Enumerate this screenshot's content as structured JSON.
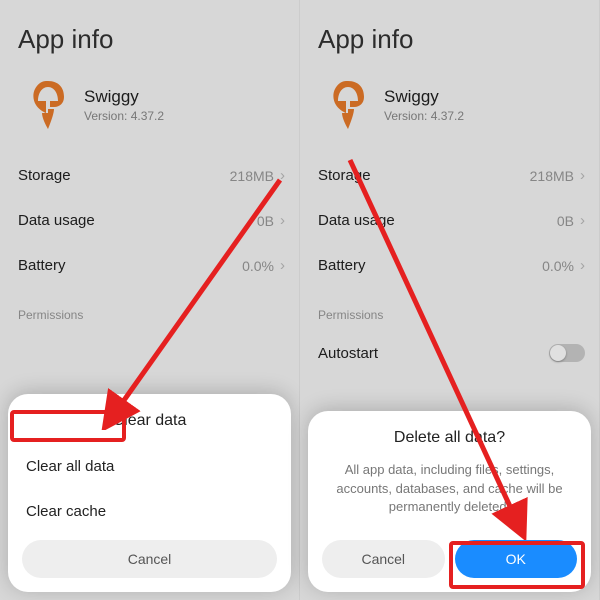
{
  "left": {
    "title": "App info",
    "app_name": "Swiggy",
    "app_version": "Version: 4.37.2",
    "rows": {
      "storage_label": "Storage",
      "storage_val": "218MB",
      "data_label": "Data usage",
      "data_val": "0B",
      "battery_label": "Battery",
      "battery_val": "0.0%"
    },
    "perm_label": "Permissions",
    "sheet": {
      "title": "Clear data",
      "item1": "Clear all data",
      "item2": "Clear cache",
      "cancel": "Cancel"
    }
  },
  "right": {
    "title": "App info",
    "app_name": "Swiggy",
    "app_version": "Version: 4.37.2",
    "rows": {
      "storage_label": "Storage",
      "storage_val": "218MB",
      "data_label": "Data usage",
      "data_val": "0B",
      "battery_label": "Battery",
      "battery_val": "0.0%"
    },
    "perm_label": "Permissions",
    "autostart_label": "Autostart",
    "sheet": {
      "title": "Delete all data?",
      "body": "All app data, including files, settings, accounts, databases, and cache will be permanently deleted.",
      "cancel": "Cancel",
      "ok": "OK"
    }
  }
}
